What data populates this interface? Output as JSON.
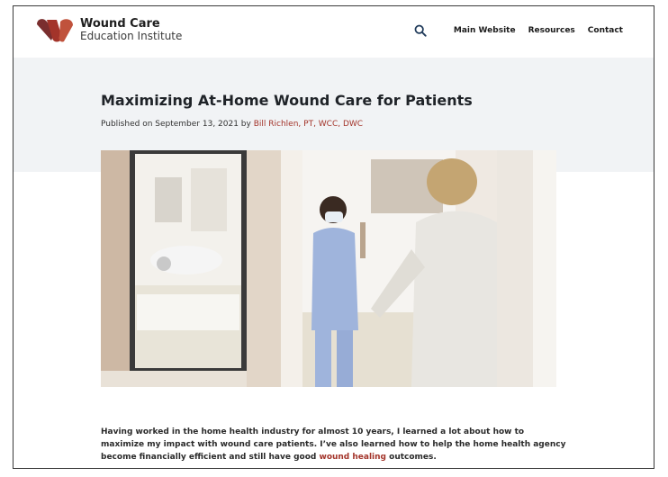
{
  "header": {
    "logo_line1": "Wound Care",
    "logo_line2": "Education Institute",
    "nav": {
      "main_website": "Main Website",
      "resources": "Resources",
      "contact": "Contact"
    }
  },
  "article": {
    "title": "Maximizing At-Home Wound Care for Patients",
    "published_prefix": "Published on September 13, 2021 by",
    "author": "Bill Richlen, PT, WCC, DWC",
    "body_part1": "Having worked in the home health industry for almost 10 years, I learned a lot about how to maximize my impact with wound care patients. I’ve also learned how to help the home health agency become financially efficient and still have good",
    "body_link": "wound healing",
    "body_part2": "outcomes."
  },
  "colors": {
    "brand_red": "#a3342a",
    "logo_dark": "#7a2e2e",
    "logo_light": "#c0523c",
    "hero_bg": "#f1f3f5"
  },
  "icons": {
    "search": "search-icon",
    "logo": "wci-logo-mark"
  }
}
